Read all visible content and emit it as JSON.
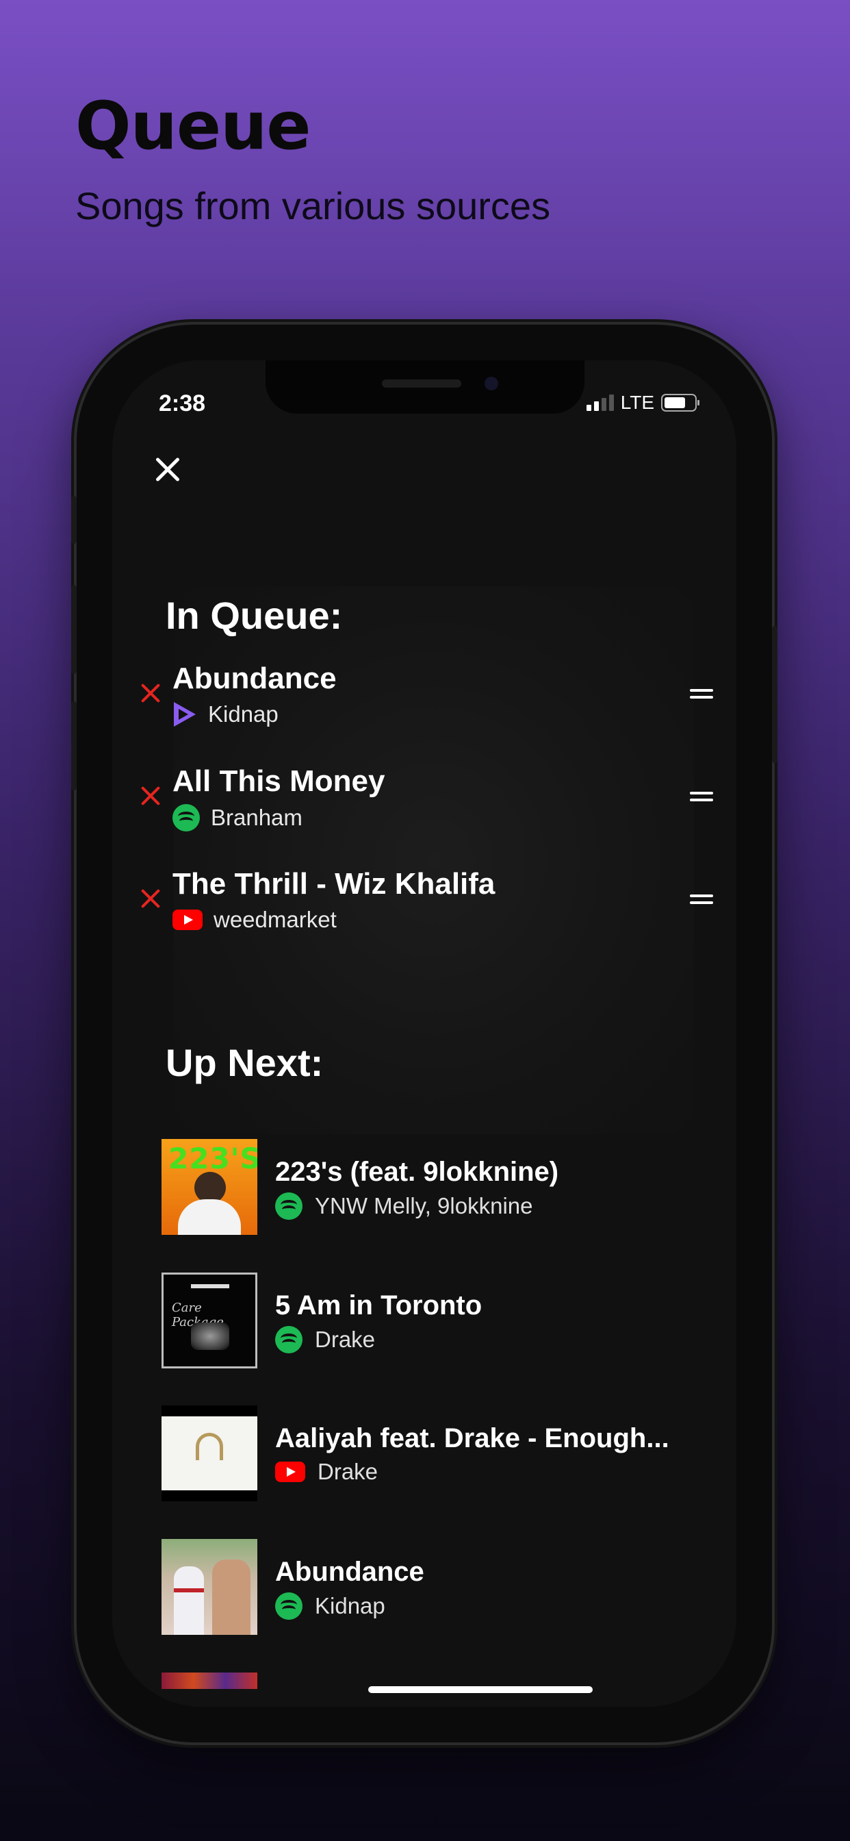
{
  "promo": {
    "title": "Queue",
    "subtitle": "Songs from various sources"
  },
  "status_bar": {
    "time": "2:38",
    "network": "LTE"
  },
  "in_queue": {
    "heading": "In Queue:",
    "items": [
      {
        "title": "Abundance",
        "artist": "Kidnap",
        "source": "play-icon"
      },
      {
        "title": "All This Money",
        "artist": "Branham",
        "source": "spotify-icon"
      },
      {
        "title": "The Thrill - Wiz Khalifa",
        "artist": "weedmarket",
        "source": "youtube-icon"
      }
    ]
  },
  "up_next": {
    "heading": "Up Next:",
    "items": [
      {
        "title": "223's (feat. 9lokknine)",
        "artist": "YNW Melly, 9lokknine",
        "source": "spotify-icon",
        "art_text": "223'S"
      },
      {
        "title": "5 Am in Toronto",
        "artist": "Drake",
        "source": "spotify-icon",
        "art_text": "Care Package"
      },
      {
        "title": "Aaliyah feat. Drake - Enough...",
        "artist": "Drake",
        "source": "youtube-icon"
      },
      {
        "title": "Abundance",
        "artist": "Kidnap",
        "source": "spotify-icon"
      }
    ]
  },
  "colors": {
    "background_top": "#7a4fc4",
    "background_bottom": "#0a0814",
    "spotify": "#1db954",
    "youtube": "#ff0000",
    "remove": "#e5251f",
    "accent_play": "#8a5cf0"
  }
}
